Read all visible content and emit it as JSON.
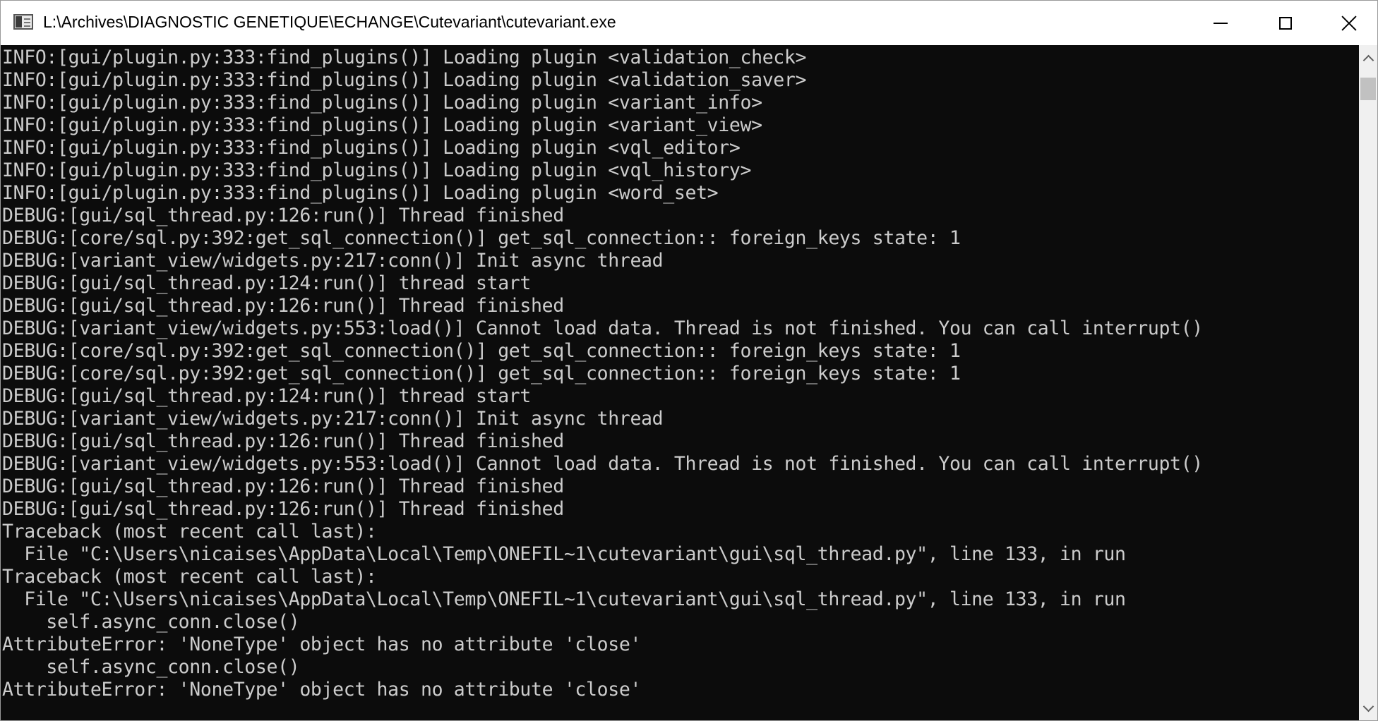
{
  "window": {
    "title": "L:\\Archives\\DIAGNOSTIC GENETIQUE\\ECHANGE\\Cutevariant\\cutevariant.exe"
  },
  "caption_buttons": {
    "minimize_icon": "minimize-icon",
    "maximize_icon": "maximize-icon",
    "close_icon": "close-icon"
  },
  "console": {
    "background": "#0c0c0c",
    "foreground": "#cccccc",
    "lines": [
      "INFO:[gui/plugin.py:333:find_plugins()] Loading plugin <validation_check>",
      "INFO:[gui/plugin.py:333:find_plugins()] Loading plugin <validation_saver>",
      "INFO:[gui/plugin.py:333:find_plugins()] Loading plugin <variant_info>",
      "INFO:[gui/plugin.py:333:find_plugins()] Loading plugin <variant_view>",
      "INFO:[gui/plugin.py:333:find_plugins()] Loading plugin <vql_editor>",
      "INFO:[gui/plugin.py:333:find_plugins()] Loading plugin <vql_history>",
      "INFO:[gui/plugin.py:333:find_plugins()] Loading plugin <word_set>",
      "DEBUG:[gui/sql_thread.py:126:run()] Thread finished",
      "DEBUG:[core/sql.py:392:get_sql_connection()] get_sql_connection:: foreign_keys state: 1",
      "DEBUG:[variant_view/widgets.py:217:conn()] Init async thread",
      "DEBUG:[gui/sql_thread.py:124:run()] thread start",
      "DEBUG:[gui/sql_thread.py:126:run()] Thread finished",
      "DEBUG:[variant_view/widgets.py:553:load()] Cannot load data. Thread is not finished. You can call interrupt()",
      "DEBUG:[core/sql.py:392:get_sql_connection()] get_sql_connection:: foreign_keys state: 1",
      "DEBUG:[core/sql.py:392:get_sql_connection()] get_sql_connection:: foreign_keys state: 1",
      "DEBUG:[gui/sql_thread.py:124:run()] thread start",
      "DEBUG:[variant_view/widgets.py:217:conn()] Init async thread",
      "DEBUG:[gui/sql_thread.py:126:run()] Thread finished",
      "DEBUG:[variant_view/widgets.py:553:load()] Cannot load data. Thread is not finished. You can call interrupt()",
      "DEBUG:[gui/sql_thread.py:126:run()] Thread finished",
      "DEBUG:[gui/sql_thread.py:126:run()] Thread finished",
      "Traceback (most recent call last):",
      "  File \"C:\\Users\\nicaises\\AppData\\Local\\Temp\\ONEFIL~1\\cutevariant\\gui\\sql_thread.py\", line 133, in run",
      "Traceback (most recent call last):",
      "  File \"C:\\Users\\nicaises\\AppData\\Local\\Temp\\ONEFIL~1\\cutevariant\\gui\\sql_thread.py\", line 133, in run",
      "    self.async_conn.close()",
      "AttributeError: 'NoneType' object has no attribute 'close'",
      "    self.async_conn.close()",
      "AttributeError: 'NoneType' object has no attribute 'close'"
    ]
  },
  "scrollbar": {
    "up_icon": "chevron-up-icon",
    "down_icon": "chevron-down-icon"
  }
}
